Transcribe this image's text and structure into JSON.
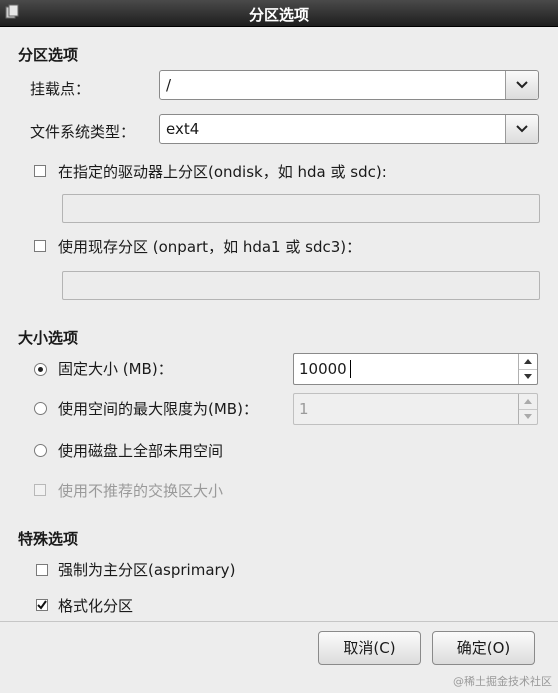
{
  "window": {
    "title": "分区选项",
    "icon": "window-app-icon"
  },
  "partition_options": {
    "heading": "分区选项",
    "mount_point": {
      "label": "挂载点：",
      "value": "/"
    },
    "fs_type": {
      "label": "文件系统类型：",
      "value": "ext4"
    },
    "ondisk": {
      "label": "在指定的驱动器上分区(ondisk，如 hda 或 sdc):",
      "checked": false,
      "value": ""
    },
    "onpart": {
      "label": "使用现存分区 (onpart，如 hda1 或 sdc3)：",
      "checked": false,
      "value": ""
    }
  },
  "size_options": {
    "heading": "大小选项",
    "fixed": {
      "label": "固定大小 (MB)：",
      "selected": true,
      "value": "10000"
    },
    "maxsize": {
      "label": "使用空间的最大限度为(MB)：",
      "selected": false,
      "value": "1"
    },
    "grow": {
      "label": "使用磁盘上全部未用空间",
      "selected": false
    },
    "recommended_swap": {
      "label": "使用不推荐的交换区大小",
      "checked": false,
      "disabled": true
    }
  },
  "special_options": {
    "heading": "特殊选项",
    "asprimary": {
      "label": "强制为主分区(asprimary)",
      "checked": false
    },
    "format": {
      "label": "格式化分区",
      "checked": true
    }
  },
  "buttons": {
    "cancel_label": "取消(C)",
    "ok_label": "确定(O)"
  },
  "watermark": "@稀土掘金技术社区"
}
